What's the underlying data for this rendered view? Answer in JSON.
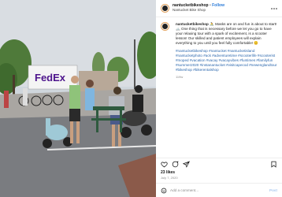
{
  "post": {
    "username": "nantucketbikeshop",
    "separator": "•",
    "follow_label": "Follow",
    "location": "Nantucket Bike Shop",
    "more_icon": "more-horizontal-icon"
  },
  "caption": {
    "username": "nantucketbikeshop",
    "text": "🚴 Masks are on and fun is about to start! 🚲 One thing that is necessary before we let you go to have your relaxing tour with a spark of excitement, is a scooter lesson! Our skilled and patient employees will explain everything to you until you feel fully comfortable! 😊",
    "hashtags": "#nantucketbikeshop #nantucket #nantucketisland #nantucketphoto #ack #adventuretime #scooterlife #scooterist #moped #vacation #vacay #vacayvibes #funtimes #familyfun #summer2020 #instanantucket #visitcapecod #newenglandtour #bikeshop #bikerentalshop",
    "time": "119w"
  },
  "photo": {
    "sign_text": "FedEx"
  },
  "actions": {
    "like_icon": "heart-icon",
    "comment_icon": "comment-icon",
    "share_icon": "share-icon",
    "save_icon": "bookmark-icon"
  },
  "likes": "23 likes",
  "date": "July 7, 2020",
  "comment": {
    "emoji_icon": "smiley-icon",
    "placeholder": "Add a comment...",
    "post_label": "Post"
  }
}
